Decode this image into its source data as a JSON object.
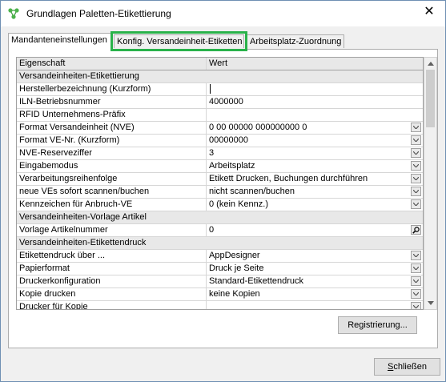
{
  "window": {
    "title": "Grundlagen Paletten-Etikettierung"
  },
  "tabs": [
    {
      "label": "Mandanteneinstellungen",
      "active": true
    },
    {
      "label": "Konfig. Versandeinheit-Etiketten",
      "highlighted": true
    },
    {
      "label": "Arbeitsplatz-Zuordnung"
    }
  ],
  "grid": {
    "headers": [
      "Eigenschaft",
      "Wert"
    ],
    "rows": [
      {
        "type": "section",
        "label": "Versandeinheiten-Etikettierung"
      },
      {
        "type": "prop",
        "label": "Herstellerbezeichnung (Kurzform)",
        "value": "",
        "editing": true
      },
      {
        "type": "prop",
        "label": "ILN-Betriebsnummer",
        "value": "4000000"
      },
      {
        "type": "prop",
        "label": "RFID Unternehmens-Präfix",
        "value": ""
      },
      {
        "type": "prop",
        "label": "Format Versandeinheit (NVE)",
        "value": "0 00 00000 000000000 0",
        "dropdown": true
      },
      {
        "type": "prop",
        "label": "Format VE-Nr. (Kurzform)",
        "value": "00000000",
        "dropdown": true
      },
      {
        "type": "prop",
        "label": "NVE-Reserveziffer",
        "value": "3",
        "dropdown": true
      },
      {
        "type": "prop",
        "label": "Eingabemodus",
        "value": "Arbeitsplatz",
        "dropdown": true
      },
      {
        "type": "prop",
        "label": "Verarbeitungsreihenfolge",
        "value": "Etikett Drucken, Buchungen durchführen",
        "dropdown": true
      },
      {
        "type": "prop",
        "label": "neue VEs sofort scannen/buchen",
        "value": "nicht scannen/buchen",
        "dropdown": true
      },
      {
        "type": "prop",
        "label": "Kennzeichen für Anbruch-VE",
        "value": "0 (kein Kennz.)",
        "dropdown": true
      },
      {
        "type": "section",
        "label": "Versandeinheiten-Vorlage Artikel"
      },
      {
        "type": "prop",
        "label": "Vorlage Artikelnummer",
        "value": "0",
        "lookup": true
      },
      {
        "type": "section",
        "label": "Versandeinheiten-Etikettendruck"
      },
      {
        "type": "prop",
        "label": "Etikettendruck über ...",
        "value": "AppDesigner",
        "dropdown": true
      },
      {
        "type": "prop",
        "label": "Papierformat",
        "value": "Druck je Seite",
        "dropdown": true
      },
      {
        "type": "prop",
        "label": "Druckerkonfiguration",
        "value": "Standard-Etikettendruck",
        "dropdown": true
      },
      {
        "type": "prop",
        "label": "Kopie drucken",
        "value": "keine Kopien",
        "dropdown": true
      },
      {
        "type": "prop",
        "label": "Drucker für Kopie",
        "value": "",
        "dropdown": true
      }
    ]
  },
  "buttons": {
    "register": "Registrierung...",
    "close_mnemonic": "S",
    "close_rest": "chließen"
  },
  "icons": {
    "app": "palette-network-icon",
    "close": "close-icon",
    "dropdown": "chevron-down-icon",
    "lookup": "magnifier-icon"
  },
  "colors": {
    "highlight": "#29b24a"
  }
}
